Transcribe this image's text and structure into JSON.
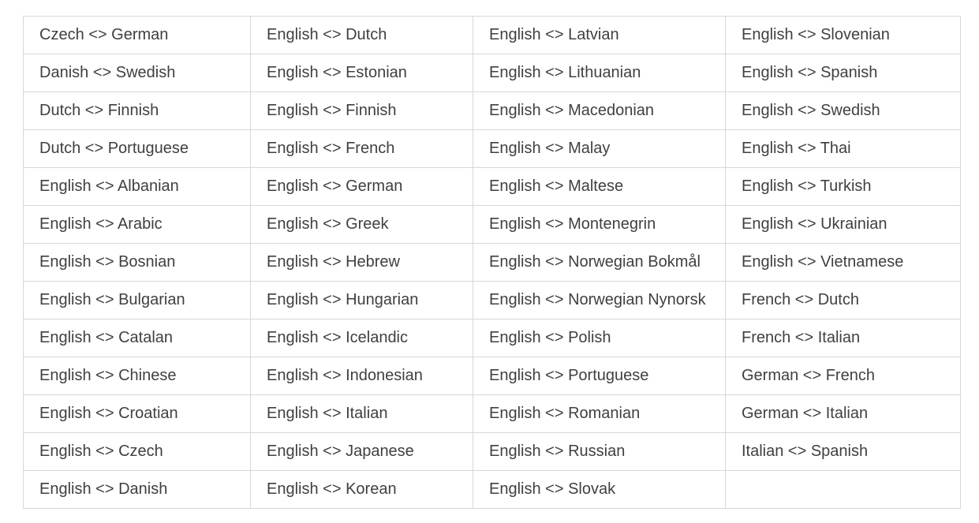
{
  "language_pairs": {
    "columns": [
      [
        "Czech <> German",
        "Danish <> Swedish",
        "Dutch <> Finnish",
        "Dutch <> Portuguese",
        "English <> Albanian",
        "English <> Arabic",
        "English <> Bosnian",
        "English <> Bulgarian",
        "English <> Catalan",
        "English <> Chinese",
        "English <> Croatian",
        "English <> Czech",
        "English <> Danish"
      ],
      [
        "English <> Dutch",
        "English <> Estonian",
        "English <> Finnish",
        "English <> French",
        "English <> German",
        "English <> Greek",
        "English <> Hebrew",
        "English <> Hungarian",
        "English <> Icelandic",
        "English <> Indonesian",
        "English <> Italian",
        "English <> Japanese",
        "English <> Korean"
      ],
      [
        "English <> Latvian",
        "English <> Lithuanian",
        "English <> Macedonian",
        "English <> Malay",
        "English <> Maltese",
        "English <> Montenegrin",
        "English <> Norwegian Bokmål",
        "English <> Norwegian Nynorsk",
        "English <> Polish",
        "English <> Portuguese",
        "English <> Romanian",
        "English <> Russian",
        "English <> Slovak"
      ],
      [
        "English <> Slovenian",
        "English <> Spanish",
        "English <> Swedish",
        "English <> Thai",
        "English <> Turkish",
        "English <> Ukrainian",
        "English <> Vietnamese",
        "French <> Dutch",
        "French <> Italian",
        "German <> French",
        "German <> Italian",
        "Italian <> Spanish",
        ""
      ]
    ]
  }
}
